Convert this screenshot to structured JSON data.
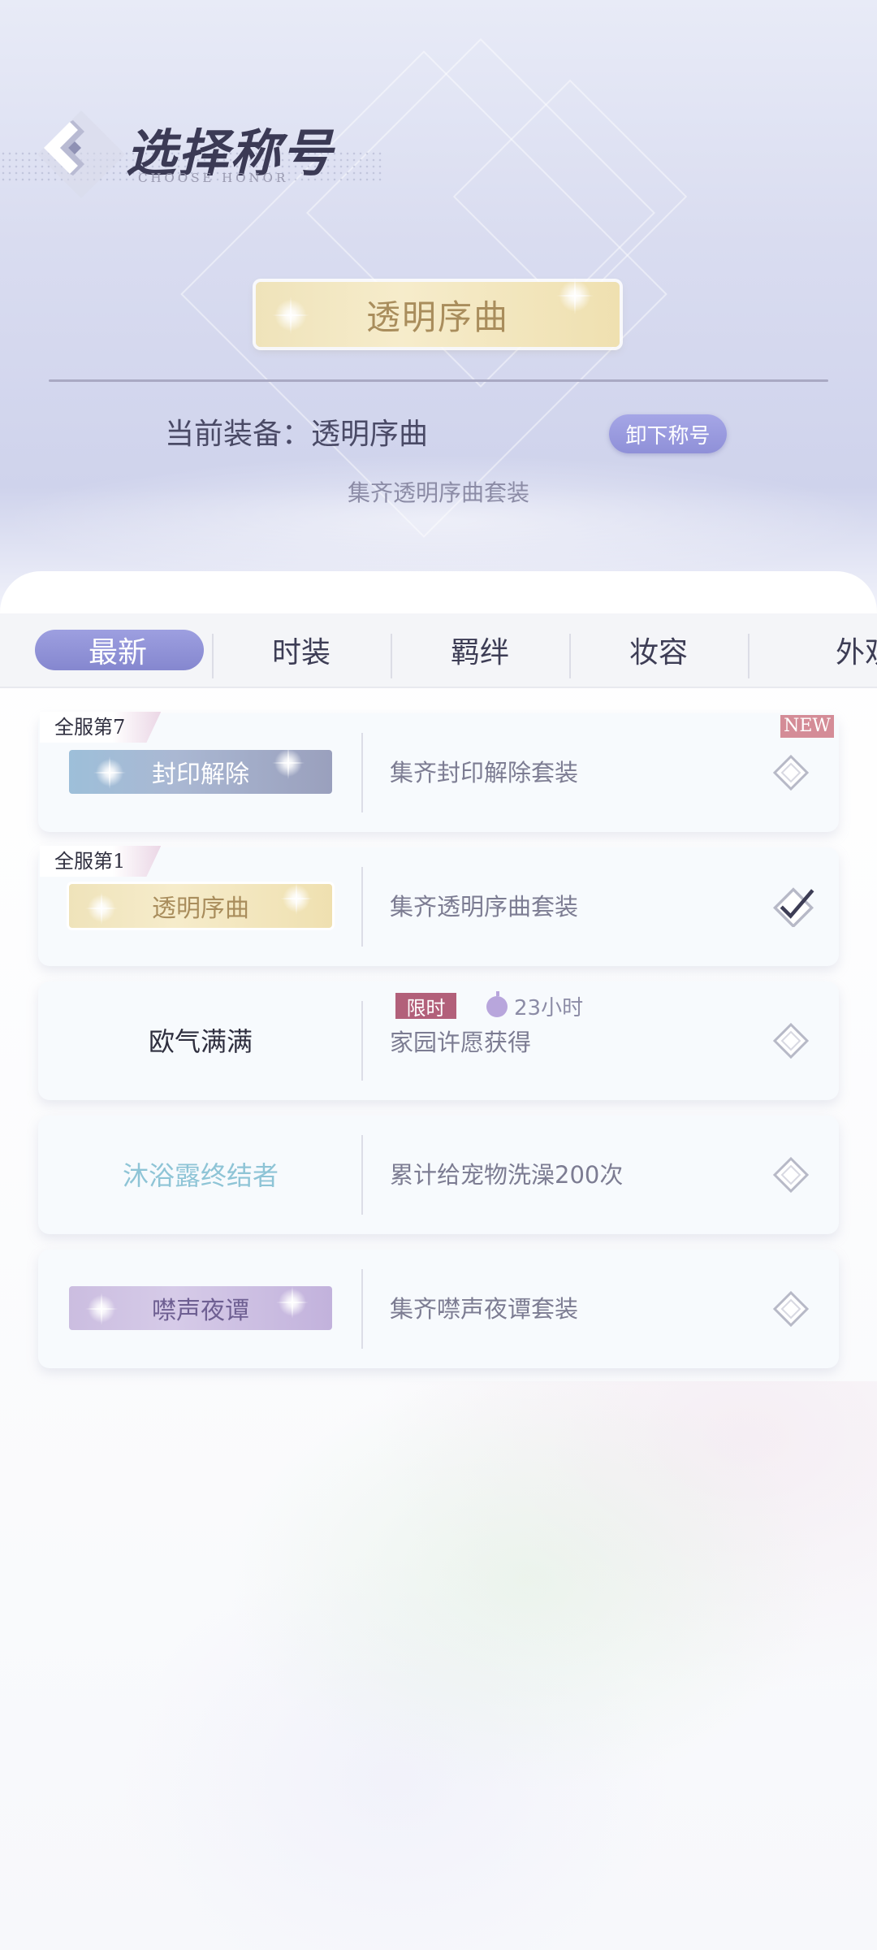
{
  "header": {
    "title": "选择称号",
    "subtitle": "CHOOSE HONOR",
    "back_icon": "chevron-left-icon"
  },
  "current": {
    "badge_label": "透明序曲",
    "equip_text": "当前装备：透明序曲",
    "unequip_label": "卸下称号",
    "description": "集齐透明序曲套装"
  },
  "tabs": [
    {
      "label": "最新",
      "active": true
    },
    {
      "label": "时装",
      "active": false
    },
    {
      "label": "羁绊",
      "active": false
    },
    {
      "label": "妆容",
      "active": false
    },
    {
      "label": "外观",
      "active": false
    }
  ],
  "honors": [
    {
      "rank": "全服第7",
      "label": "封印解除",
      "description": "集齐封印解除套装",
      "equipped": false,
      "new": "NEW",
      "style": "blue-gray"
    },
    {
      "rank": "全服第1",
      "label": "透明序曲",
      "description": "集齐透明序曲套装",
      "equipped": true,
      "style": "gold"
    },
    {
      "label": "欧气满满",
      "description": "家园许愿获得",
      "equipped": false,
      "limited": "限时",
      "timer": "23小时",
      "style": "plain-dark"
    },
    {
      "label": "沐浴露终结者",
      "description": "累计给宠物洗澡200次",
      "equipped": false,
      "style": "plain-teal"
    },
    {
      "label": "噤声夜谭",
      "description": "集齐噤声夜谭套装",
      "equipped": false,
      "style": "purple"
    }
  ],
  "colors": {
    "accent": "#8f90d8",
    "rank_new": "#d48c97",
    "limited": "#b2607a"
  }
}
